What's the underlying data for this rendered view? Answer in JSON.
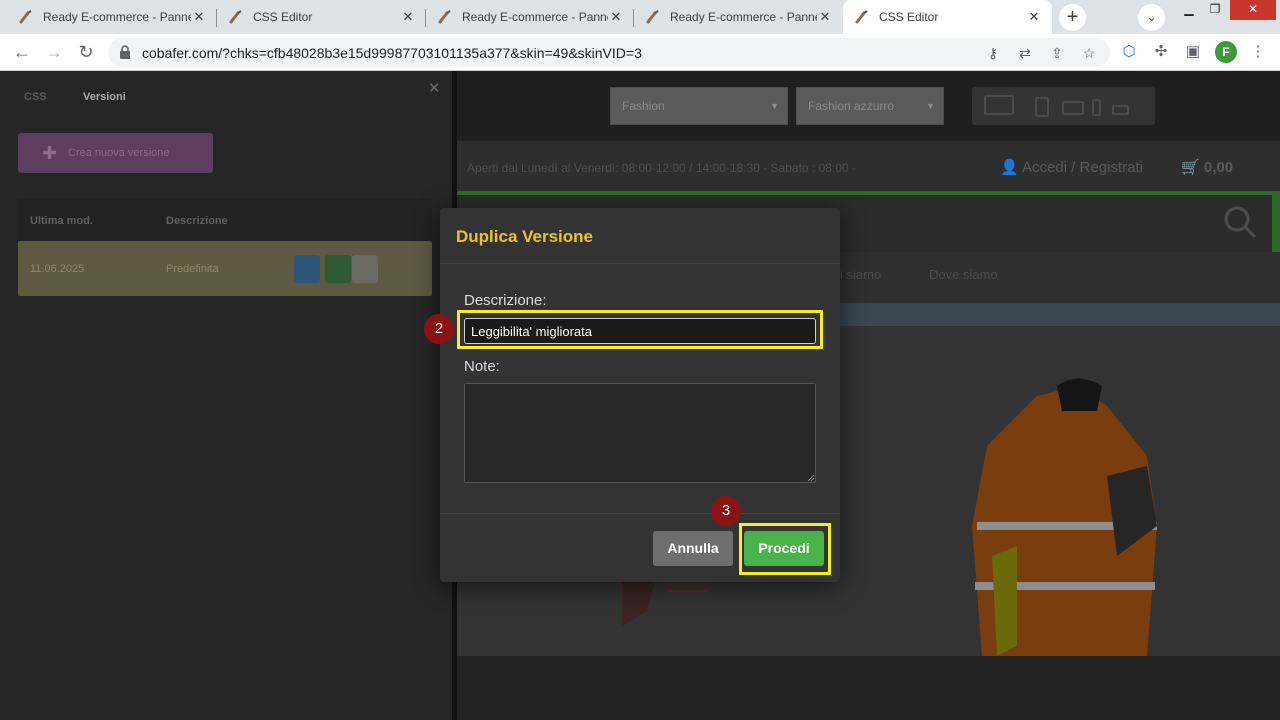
{
  "browser": {
    "tabs": [
      {
        "title": "Ready E-commerce - Pannello",
        "active": false
      },
      {
        "title": "CSS Editor",
        "active": false
      },
      {
        "title": "Ready E-commerce - Pannello",
        "active": false
      },
      {
        "title": "Ready E-commerce - Pannello",
        "active": false
      },
      {
        "title": "CSS Editor",
        "active": true
      }
    ],
    "url": "cobafer.com/?chks=cfb48028b3e15d99987703101135a377&skin=49&skinVID=3",
    "profile_initial": "F",
    "icons": {
      "back": "back-arrow-icon",
      "forward": "forward-arrow-icon",
      "reload": "reload-icon",
      "lock": "lock-icon",
      "key": "key-icon",
      "translate": "translate-icon",
      "share": "share-icon",
      "bookmark": "star-icon",
      "extension": "puzzle-icon",
      "sidepanel": "side-panel-icon",
      "menu": "kebab-menu-icon"
    }
  },
  "left_panel": {
    "tabs": [
      "CSS",
      "Versioni"
    ],
    "new_version_label": "Crea nuova versione",
    "table": {
      "headers": [
        "Ultima mod.",
        "Descrizione"
      ],
      "rows": [
        {
          "date": "11.06.2025",
          "description": "Predefinita"
        }
      ]
    }
  },
  "preview": {
    "theme_select": "Fashion",
    "variant_select": "Fashion azzurro",
    "hours": "Aperti dal Lunedì al Venerdì: 08:00-12:00 / 14:00-18:30 - Sabato : 08:00 -",
    "login": "Accedi / Registrati",
    "cart_total": "0,00",
    "nav": [
      "i siamo",
      "Dove siamo"
    ]
  },
  "dialog": {
    "title": "Duplica Versione",
    "description_label": "Descrizione:",
    "description_value": "Leggibilita' migliorata",
    "notes_label": "Note:",
    "notes_value": "",
    "cancel_label": "Annulla",
    "proceed_label": "Procedi"
  },
  "annotations": {
    "step_description": "2",
    "step_proceed": "3",
    "highlight_color": "#f7ee1b",
    "step_color": "#8a1212"
  },
  "colors": {
    "dialog_title": "#f3c417",
    "proceed_button": "#49b24a",
    "cancel_button": "#6e6e6e"
  }
}
